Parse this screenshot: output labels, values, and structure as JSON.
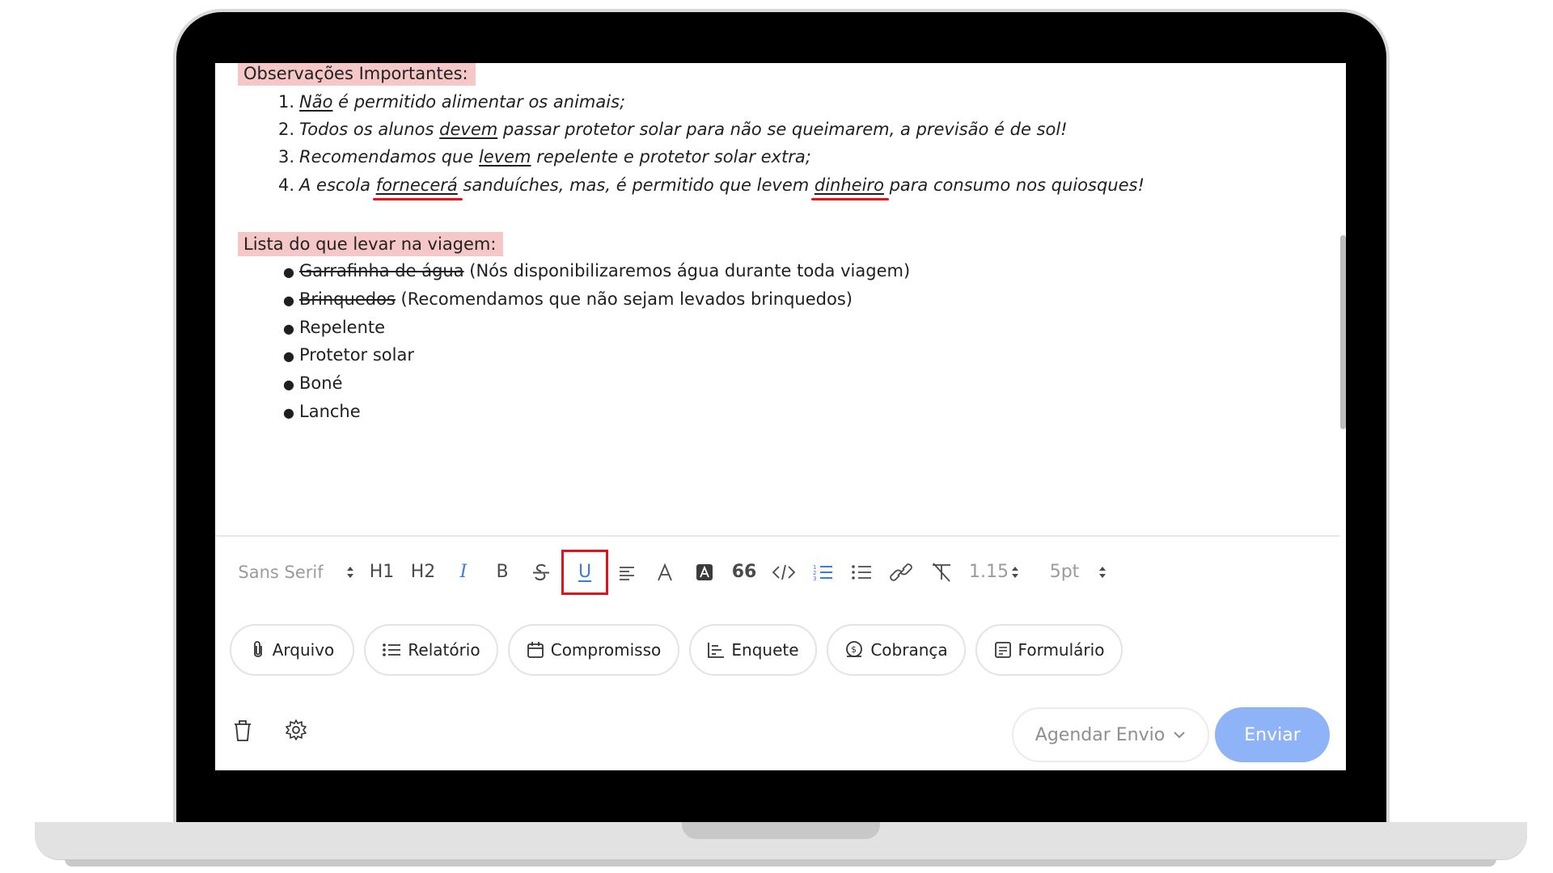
{
  "document": {
    "section1_title": "Observações Importantes:",
    "ordered_list": [
      {
        "num": "1.",
        "parts": [
          "",
          "Não",
          " é permitido alimentar os animais;",
          "",
          ""
        ]
      },
      {
        "num": "2.",
        "parts": [
          "Todos os alunos ",
          "devem",
          " passar protetor solar para não se queimarem, a previsão é de sol!",
          "",
          ""
        ]
      },
      {
        "num": "3.",
        "parts": [
          "Recomendamos que ",
          "levem",
          " repelente e protetor solar extra;",
          "",
          ""
        ]
      },
      {
        "num": "4.",
        "parts": [
          "A escola ",
          "fornecerá",
          " sanduíches, mas, é permitido que levem ",
          "dinheiro",
          " para consumo nos quiosques!"
        ]
      }
    ],
    "section2_title": "Lista do que levar na viagem:",
    "bullet_list": [
      {
        "strike": "Garrafinha de água",
        "rest": " (Nós disponibilizaremos água durante toda viagem)"
      },
      {
        "strike": "Brinquedos",
        "rest": " (Recomendamos que não sejam levados brinquedos)"
      },
      {
        "strike": "",
        "rest": "Repelente"
      },
      {
        "strike": "",
        "rest": "Protetor solar"
      },
      {
        "strike": "",
        "rest": "Boné"
      },
      {
        "strike": "",
        "rest": "Lanche"
      }
    ]
  },
  "toolbar": {
    "font_family": "Sans Serif",
    "h1": "H1",
    "h2": "H2",
    "bold": "B",
    "italic": "I",
    "underline": "U",
    "text_color": "A",
    "bg_color": "A",
    "quote": "66",
    "line_height": "1.15",
    "font_size": "5pt"
  },
  "chips": {
    "file": "Arquivo",
    "report": "Relatório",
    "appointment": "Compromisso",
    "poll": "Enquete",
    "charge": "Cobrança",
    "form": "Formulário"
  },
  "footer": {
    "schedule": "Agendar Envio",
    "send": "Enviar"
  },
  "colors": {
    "highlight_bg": "#f6c7c7",
    "accent_blue": "#3a7be0",
    "send_button": "#8fb3f7",
    "focus_box": "#e0121b"
  }
}
